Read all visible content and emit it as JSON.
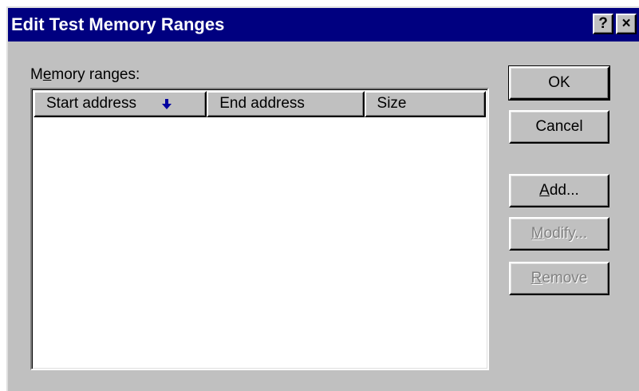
{
  "dialog": {
    "title": "Edit Test Memory Ranges",
    "help_glyph": "?",
    "close_glyph": "×"
  },
  "ranges": {
    "label_prefix": "M",
    "label_mnemonic": "e",
    "label_suffix": "mory ranges:",
    "columns": [
      "Start address",
      "End address",
      "Size"
    ],
    "sort_column": "Start address",
    "sort_icon": "sort-down-arrow-icon",
    "rows": []
  },
  "buttons": {
    "ok": {
      "label": "OK"
    },
    "cancel": {
      "label": "Cancel"
    },
    "add": {
      "mnemonic": "A",
      "rest": "dd...",
      "enabled": true
    },
    "modify": {
      "mnemonic": "M",
      "rest": "odify...",
      "enabled": false
    },
    "remove": {
      "mnemonic": "R",
      "rest": "emove",
      "enabled": false
    }
  },
  "colors": {
    "titlebar": "#000080",
    "face": "#c0c0c0",
    "sort_arrow": "#0000a0"
  }
}
